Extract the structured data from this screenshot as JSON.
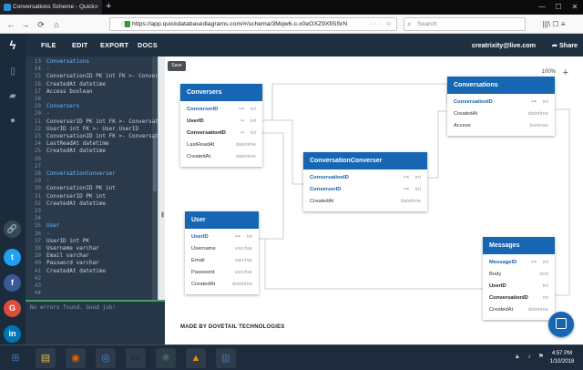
{
  "browser": {
    "tab_title": "Conversations Scheme - Quick",
    "tab_close": "×",
    "new_tab": "+",
    "url": "https://app.quickdatabasediagrams.com/#/schema/3Mqw6-c-x0eOXZ9XfiSSrN",
    "search_placeholder": "Search",
    "back": "←",
    "forward": "→",
    "reload": "⟳",
    "home": "⌂",
    "url_actions": "··· ☆",
    "win_min": "—",
    "win_max": "☐",
    "win_close": "✕",
    "toolbar_icons": "|||\\ ☐ ≡"
  },
  "app": {
    "logo": "ϟ",
    "menu": [
      "FILE",
      "EDIT",
      "EXPORT",
      "DOCS"
    ],
    "user_email": "creatrixity@live.com",
    "share_label": "Share",
    "save_label": "Save",
    "zoom_label": "100%",
    "zoom_plus": "+",
    "made_by": "MADE BY DOVETAIL TECHNOLOGIES",
    "status_text": "No errors found. Good job!",
    "sidebar_icons": [
      "file-icon",
      "folder-icon",
      "user-icon"
    ],
    "social": [
      {
        "label": "🔗",
        "color": "#3a4754"
      },
      {
        "label": "t",
        "color": "#1da1f2"
      },
      {
        "label": "f",
        "color": "#3b5998"
      },
      {
        "label": "G",
        "color": "#dd4b39"
      },
      {
        "label": "in",
        "color": "#0077b5"
      }
    ]
  },
  "editor": {
    "lines": [
      {
        "n": "13",
        "t": "Conversations",
        "c": "#6fb7ff"
      },
      {
        "n": "14",
        "t": "-",
        "c": "#9fb0c0"
      },
      {
        "n": "15",
        "t": "ConversationID PK int FK >- Conver",
        "c": "#c8d3de"
      },
      {
        "n": "16",
        "t": "CreatedAt datetime",
        "c": "#c8d3de"
      },
      {
        "n": "17",
        "t": "Access boolean",
        "c": "#c8d3de"
      },
      {
        "n": "18",
        "t": "",
        "c": "#c8d3de"
      },
      {
        "n": "19",
        "t": "Conversers",
        "c": "#6fb7ff"
      },
      {
        "n": "20",
        "t": "-",
        "c": "#9fb0c0"
      },
      {
        "n": "21",
        "t": "ConverserID PK int FK >- Conversat",
        "c": "#c8d3de"
      },
      {
        "n": "22",
        "t": "UserID int FK >- User.UserID",
        "c": "#c8d3de"
      },
      {
        "n": "23",
        "t": "ConversationID int FK >- Conversat",
        "c": "#c8d3de"
      },
      {
        "n": "24",
        "t": "LastReadAt datetime",
        "c": "#c8d3de"
      },
      {
        "n": "25",
        "t": "CreatedAt datetime",
        "c": "#c8d3de"
      },
      {
        "n": "26",
        "t": "",
        "c": "#c8d3de"
      },
      {
        "n": "27",
        "t": "",
        "c": "#c8d3de"
      },
      {
        "n": "28",
        "t": "ConversationConverser",
        "c": "#6fb7ff"
      },
      {
        "n": "29",
        "t": "-",
        "c": "#9fb0c0"
      },
      {
        "n": "30",
        "t": "ConversationID PK int",
        "c": "#c8d3de"
      },
      {
        "n": "31",
        "t": "ConverserID PK int",
        "c": "#c8d3de"
      },
      {
        "n": "32",
        "t": "CreatedAt datetime",
        "c": "#c8d3de"
      },
      {
        "n": "33",
        "t": "",
        "c": "#c8d3de"
      },
      {
        "n": "34",
        "t": "",
        "c": "#c8d3de"
      },
      {
        "n": "35",
        "t": "User",
        "c": "#6fb7ff"
      },
      {
        "n": "36",
        "t": "-",
        "c": "#9fb0c0"
      },
      {
        "n": "37",
        "t": "UserID int PK",
        "c": "#c8d3de"
      },
      {
        "n": "38",
        "t": "Username varchar",
        "c": "#c8d3de"
      },
      {
        "n": "39",
        "t": "Email varchar",
        "c": "#c8d3de"
      },
      {
        "n": "40",
        "t": "Password varchar",
        "c": "#c8d3de"
      },
      {
        "n": "41",
        "t": "CreatedAt datetime",
        "c": "#c8d3de"
      },
      {
        "n": "42",
        "t": "",
        "c": "#c8d3de"
      },
      {
        "n": "43",
        "t": "",
        "c": "#c8d3de"
      },
      {
        "n": "44",
        "t": "",
        "c": "#c8d3de"
      }
    ]
  },
  "tables": {
    "conversers": {
      "title": "Conversers",
      "rows": [
        {
          "name": "ConverserID",
          "type": "int",
          "kind": "pk",
          "key": "⊶"
        },
        {
          "name": "UserID",
          "type": "int",
          "kind": "fk",
          "key": "⊸"
        },
        {
          "name": "ConversationID",
          "type": "int",
          "kind": "fk",
          "key": "⊸"
        },
        {
          "name": "LastReadAt",
          "type": "datetime",
          "kind": "",
          "key": ""
        },
        {
          "name": "CreatedAt",
          "type": "datetime",
          "kind": "",
          "key": ""
        }
      ]
    },
    "conversations": {
      "title": "Conversations",
      "rows": [
        {
          "name": "ConversationID",
          "type": "int",
          "kind": "pk",
          "key": "⊶"
        },
        {
          "name": "CreatedAt",
          "type": "datetime",
          "kind": "",
          "key": ""
        },
        {
          "name": "Access",
          "type": "boolean",
          "kind": "",
          "key": ""
        }
      ]
    },
    "convconv": {
      "title": "ConversationConverser",
      "rows": [
        {
          "name": "ConversationID",
          "type": "int",
          "kind": "pk",
          "key": "⊶"
        },
        {
          "name": "ConverserID",
          "type": "int",
          "kind": "pk",
          "key": "⊶"
        },
        {
          "name": "CreatedAt",
          "type": "datetime",
          "kind": "",
          "key": ""
        }
      ]
    },
    "user": {
      "title": "User",
      "rows": [
        {
          "name": "UserID",
          "type": "int",
          "kind": "pk",
          "key": "⊶"
        },
        {
          "name": "Username",
          "type": "varchar",
          "kind": "",
          "key": ""
        },
        {
          "name": "Email",
          "type": "varchar",
          "kind": "",
          "key": ""
        },
        {
          "name": "Password",
          "type": "varchar",
          "kind": "",
          "key": ""
        },
        {
          "name": "CreatedAt",
          "type": "datetime",
          "kind": "",
          "key": ""
        }
      ]
    },
    "messages": {
      "title": "Messages",
      "rows": [
        {
          "name": "MessageID",
          "type": "int",
          "kind": "pk",
          "key": "⊶"
        },
        {
          "name": "Body",
          "type": "text",
          "kind": "",
          "key": ""
        },
        {
          "name": "UserID",
          "type": "int",
          "kind": "fk",
          "key": ""
        },
        {
          "name": "ConversationID",
          "type": "int",
          "kind": "fk",
          "key": ""
        },
        {
          "name": "CreatedAt",
          "type": "datetime",
          "kind": "",
          "key": ""
        }
      ]
    }
  },
  "taskbar": {
    "apps": [
      {
        "name": "start-button",
        "glyph": "⊞",
        "color": "#3a7ac0"
      },
      {
        "name": "explorer-app",
        "glyph": "▤",
        "color": "#e2b440"
      },
      {
        "name": "firefox-app",
        "glyph": "◉",
        "color": "#e66000"
      },
      {
        "name": "chrome-app",
        "glyph": "◎",
        "color": "#4285f4"
      },
      {
        "name": "terminal-app",
        "glyph": "▭",
        "color": "#222"
      },
      {
        "name": "atom-app",
        "glyph": "⚛",
        "color": "#5fb57d"
      },
      {
        "name": "vlc-app",
        "glyph": "▲",
        "color": "#f08a00"
      },
      {
        "name": "file-manager-app",
        "glyph": "▥",
        "color": "#4b6ea8"
      }
    ],
    "tray": "▲ ♪ ⚑",
    "time": "4:57 PM",
    "date": "1/10/2018"
  }
}
